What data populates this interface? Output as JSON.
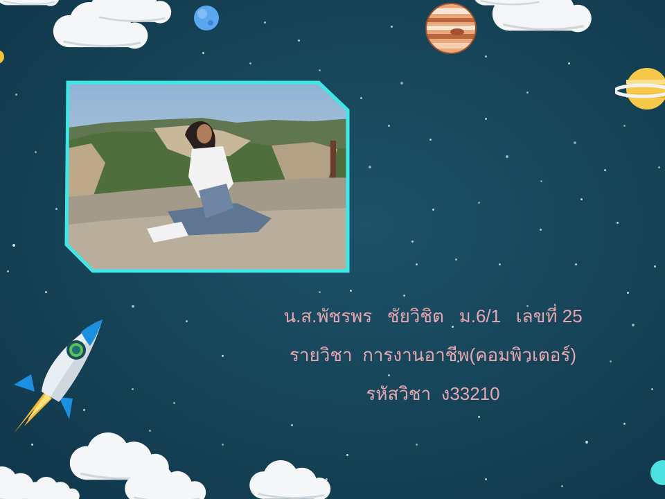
{
  "slide": {
    "background_color": "#174559",
    "accent_color": "#3ee6e6",
    "text_color": "#e5a6b0",
    "lines": [
      "น.ส.พัชรพร   ชัยวิชิต   ม.6/1   เลขที่ 25",
      "รายวิชา  การงานอาชีพ(คอมพิวเตอร์)",
      "รหัสวิชา  ง33210"
    ],
    "photo": {
      "description_icon": "portrait-photo",
      "frame_color": "#3ee6e6"
    },
    "decorations": [
      "cloud-icon",
      "planet-blue-icon",
      "planet-jupiter-icon",
      "planet-saturn-icon",
      "rocket-icon",
      "star-dots"
    ]
  }
}
